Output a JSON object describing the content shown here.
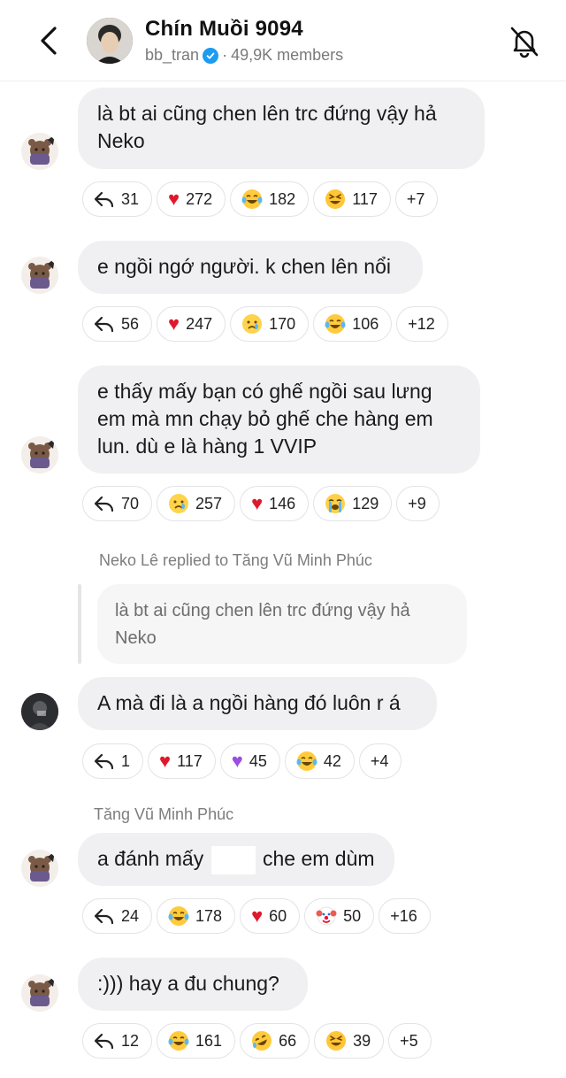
{
  "header": {
    "title": "Chín Muồi 9094",
    "handle": "bb_tran",
    "member_count": "49,9K members",
    "icons": [
      "back-arrow-icon",
      "verified-badge-icon",
      "bell-muted-icon"
    ]
  },
  "messages": [
    {
      "text": "là bt ai cũng chen lên trc đứng vậy hả Neko",
      "reactions": [
        {
          "icon": "reply-arrow-icon",
          "count": "31"
        },
        {
          "icon": "red-heart-icon",
          "count": "272"
        },
        {
          "icon": "tears-of-joy-icon",
          "count": "182"
        },
        {
          "icon": "grinning-squint-icon",
          "count": "117"
        },
        {
          "more": "+7"
        }
      ]
    },
    {
      "text": "e ngồi ngớ người. k chen lên nổi",
      "reactions": [
        {
          "icon": "reply-arrow-icon",
          "count": "56"
        },
        {
          "icon": "red-heart-icon",
          "count": "247"
        },
        {
          "icon": "crying-face-icon",
          "count": "170"
        },
        {
          "icon": "tears-of-joy-icon",
          "count": "106"
        },
        {
          "more": "+12"
        }
      ]
    },
    {
      "text": "e thấy mấy bạn có ghế ngồi sau lưng em mà mn chạy bỏ ghế che hàng em lun. dù e là hàng 1 VVIP",
      "reactions": [
        {
          "icon": "reply-arrow-icon",
          "count": "70"
        },
        {
          "icon": "crying-face-icon",
          "count": "257"
        },
        {
          "icon": "red-heart-icon",
          "count": "146"
        },
        {
          "icon": "loudly-crying-icon",
          "count": "129"
        },
        {
          "more": "+9"
        }
      ]
    },
    {
      "reply_meta": "Neko Lê replied to Tăng Vũ Minh Phúc",
      "quote": "là bt ai cũng chen lên trc đứng vậy hả Neko",
      "text": "A mà đi là a ngồi hàng đó luôn r á",
      "reactions": [
        {
          "icon": "reply-arrow-icon",
          "count": "1"
        },
        {
          "icon": "red-heart-icon",
          "count": "117"
        },
        {
          "icon": "purple-heart-icon",
          "count": "45"
        },
        {
          "icon": "tears-of-joy-icon",
          "count": "42"
        },
        {
          "more": "+4"
        }
      ]
    },
    {
      "sender": "Tăng Vũ Minh Phúc",
      "text_before": "a đánh mấy",
      "text_after": "che em dùm",
      "reactions": [
        {
          "icon": "reply-arrow-icon",
          "count": "24"
        },
        {
          "icon": "tears-of-joy-icon",
          "count": "178"
        },
        {
          "icon": "red-heart-icon",
          "count": "60"
        },
        {
          "icon": "clown-face-icon",
          "count": "50"
        },
        {
          "more": "+16"
        }
      ]
    },
    {
      "text": ":))) hay a đu chung?",
      "reactions": [
        {
          "icon": "reply-arrow-icon",
          "count": "12"
        },
        {
          "icon": "tears-of-joy-icon",
          "count": "161"
        },
        {
          "icon": "rofl-icon",
          "count": "66"
        },
        {
          "icon": "grinning-squint-icon",
          "count": "39"
        },
        {
          "more": "+5"
        }
      ]
    }
  ],
  "colors": {
    "bubble": "#f0f0f2",
    "verified": "#1d9bf0",
    "heart": "#e0182d",
    "secondary_text": "#7a7a7a"
  }
}
